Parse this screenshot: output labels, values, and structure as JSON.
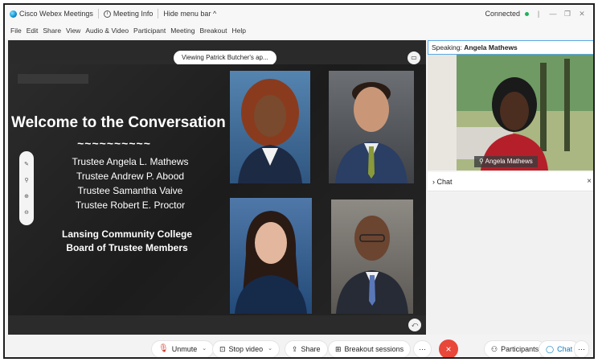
{
  "titlebar": {
    "app_name": "Cisco Webex Meetings",
    "meeting_info": "Meeting Info",
    "hide_menu": "Hide menu bar ^",
    "status": "Connected"
  },
  "menu": [
    "File",
    "Edit",
    "Share",
    "View",
    "Audio & Video",
    "Participant",
    "Meeting",
    "Breakout",
    "Help"
  ],
  "share": {
    "viewing_label": "Viewing Patrick Butcher's ap...",
    "slide": {
      "title": "Welcome to the Conversation",
      "divider": "~~~~~~~~~~",
      "trustees": [
        "Trustee Angela L. Mathews",
        "Trustee Andrew P. Abood",
        "Trustee Samantha Vaive",
        "Trustee Robert E. Proctor"
      ],
      "college_line1": "Lansing Community College",
      "college_line2": "Board of Trustee Members"
    }
  },
  "speaker": {
    "label": "Speaking:",
    "name": "Angela Mathews",
    "video_name_tag": "Angela Mathews"
  },
  "chat_panel": {
    "title": "Chat",
    "close": "×"
  },
  "controls": {
    "unmute": "Unmute",
    "stop_video": "Stop video",
    "share": "Share",
    "breakout": "Breakout sessions",
    "more": "···",
    "end": "×",
    "participants": "Participants",
    "chat": "Chat",
    "more_right": "···"
  },
  "colors": {
    "end_call": "#e8473a",
    "connected": "#20b25c",
    "accent": "#0a7cc4"
  }
}
